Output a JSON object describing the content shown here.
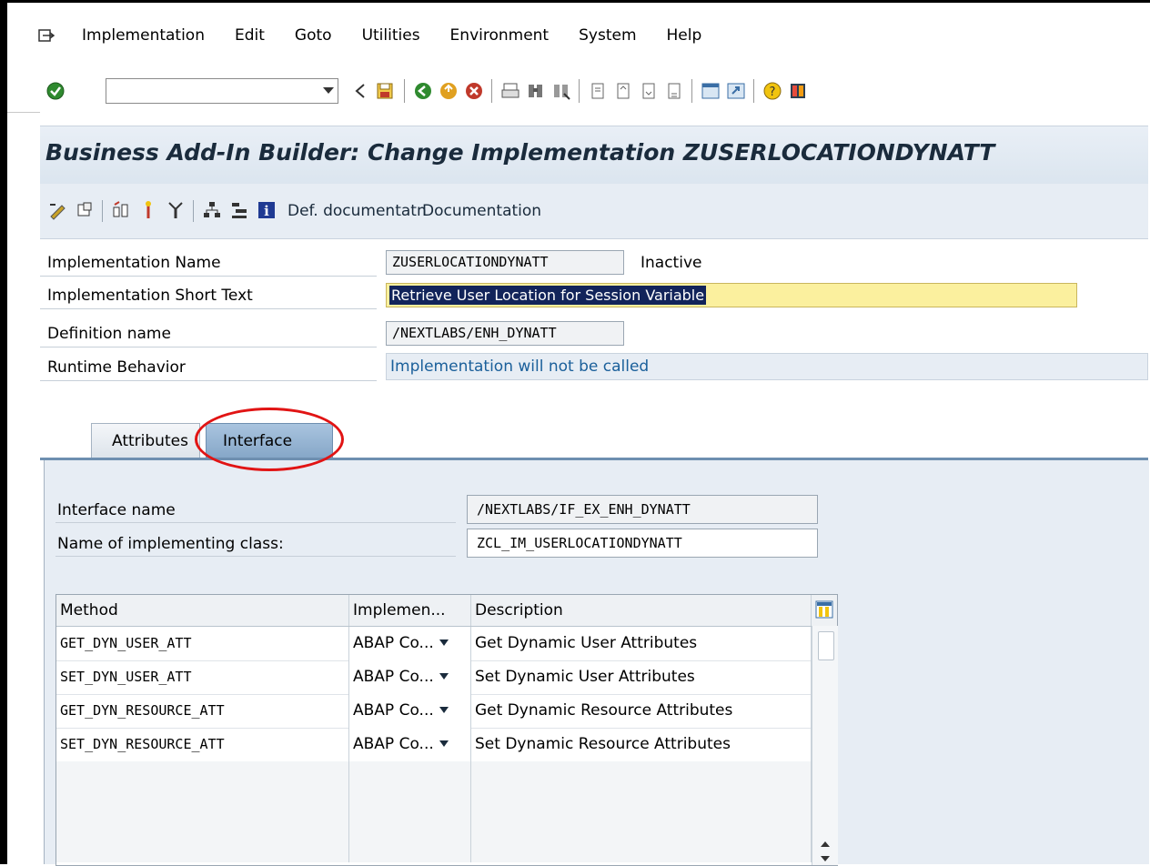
{
  "menu": {
    "items": [
      "Implementation",
      "Edit",
      "Goto",
      "Utilities",
      "Environment",
      "System",
      "Help"
    ]
  },
  "toolbar": {
    "command_field_value": "",
    "icons": [
      "enter-icon",
      "back-icon",
      "save-icon",
      "back-nav-icon",
      "exit-icon",
      "cancel-icon",
      "print-icon",
      "find-icon",
      "find-next-icon",
      "first-page-icon",
      "previous-page-icon",
      "next-page-icon",
      "last-page-icon",
      "create-session-icon",
      "create-shortcut-icon",
      "help-icon",
      "customize-layout-icon"
    ]
  },
  "screen": {
    "title": "Business Add-In Builder: Change Implementation ZUSERLOCATIONDYNATT",
    "app_toolbar": {
      "icons": [
        "display-change-icon",
        "other-object-icon",
        "check-icon",
        "activate-icon",
        "deactivate-icon",
        "hierarchy-icon",
        "tree-icon",
        "info-icon"
      ],
      "def_doc_label": "Def. documentatn",
      "doc_label": "Documentation"
    }
  },
  "fields": {
    "impl_name": {
      "label": "Implementation Name",
      "value": "ZUSERLOCATIONDYNATT",
      "status": "Inactive"
    },
    "short_text": {
      "label": "Implementation Short Text",
      "value": "Retrieve User Location for Session Variable"
    },
    "def_name": {
      "label": "Definition name",
      "value": "/NEXTLABS/ENH_DYNATT"
    },
    "runtime": {
      "label": "Runtime Behavior",
      "value": "Implementation will not be called"
    }
  },
  "tabs": {
    "attributes": "Attributes",
    "interface": "Interface",
    "active": "interface"
  },
  "interface_panel": {
    "interface_name_label": "Interface name",
    "interface_name_value": "/NEXTLABS/IF_EX_ENH_DYNATT",
    "impl_class_label": "Name of implementing class:",
    "impl_class_value": "ZCL_IM_USERLOCATIONDYNATT"
  },
  "methods_table": {
    "headers": {
      "method": "Method",
      "impl_type": "Implemen...",
      "description": "Description"
    },
    "rows": [
      {
        "method": "GET_DYN_USER_ATT",
        "impl_type": "ABAP Co...",
        "description": "Get Dynamic User Attributes"
      },
      {
        "method": "SET_DYN_USER_ATT",
        "impl_type": "ABAP Co...",
        "description": "Set Dynamic User Attributes"
      },
      {
        "method": "GET_DYN_RESOURCE_ATT",
        "impl_type": "ABAP Co...",
        "description": "Get Dynamic Resource Attributes"
      },
      {
        "method": "SET_DYN_RESOURCE_ATT",
        "impl_type": "ABAP Co...",
        "description": "Set Dynamic Resource Attributes"
      }
    ]
  },
  "colors": {
    "highlight_ellipse": "#e11414",
    "active_tab": "#86a7c8",
    "selection": "#12245a",
    "short_text_bg": "#fbf09e"
  }
}
